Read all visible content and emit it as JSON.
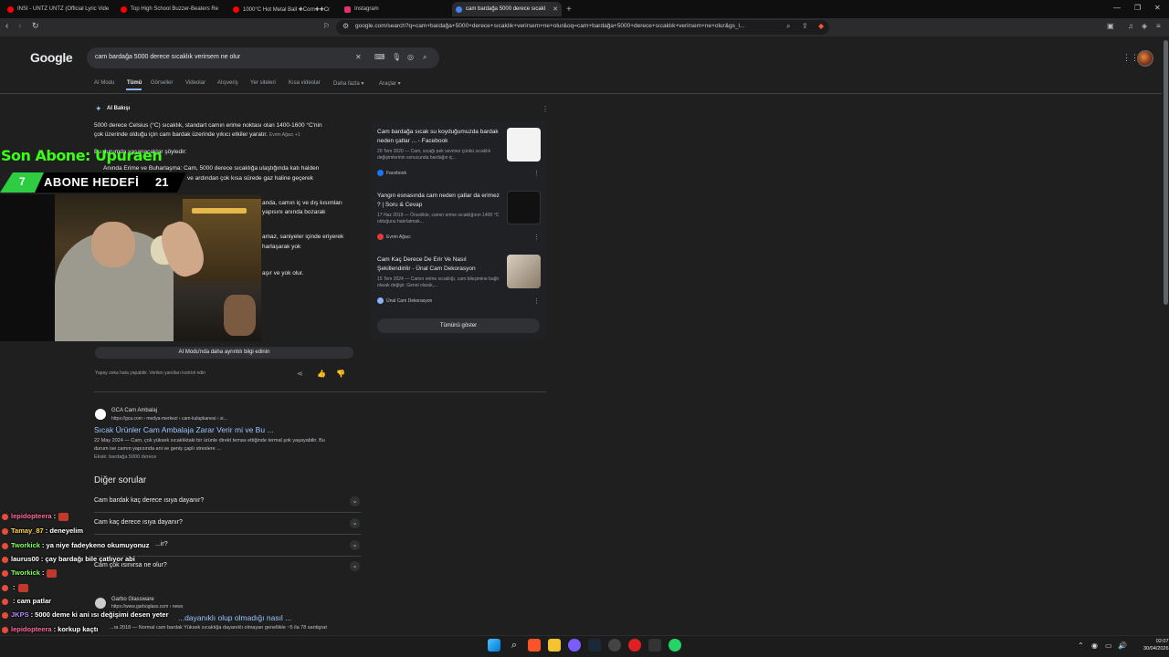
{
  "browser": {
    "tabs": [
      {
        "label": "INSI - UNTZ UNTZ (Official Lyric Vide",
        "color": "#ff0000"
      },
      {
        "label": "Top High School Buzzer-Beaters Re",
        "color": "#ff0000"
      },
      {
        "label": "1000°C Hot Metal Ball ✚Corn✚✚Cr",
        "color": "#ff0000"
      },
      {
        "label": "Instagram",
        "color": "#e1306c"
      },
      {
        "label": "cam bardağa 5000 derece sıcakl",
        "color": "#4285f4"
      }
    ],
    "new_tab": "+",
    "url": "google.com/search?q=cam+bardağa+5000+derece+sıcaklık+verirsem+ne+olur&oq=cam+bardağa+5000+derece+sıcaklık+verirsem+ne+olur&gs_l..."
  },
  "google": {
    "logo": "Google",
    "query": "cam bardağa 5000 derece sıcaklık verirsem ne olur",
    "filters": [
      "AI Modu",
      "Tümü",
      "Görseller",
      "Videolar",
      "Alışveriş",
      "Yer siteleri",
      "Kısa videolar",
      "Daha fazla ▾",
      "Araçlar ▾"
    ]
  },
  "ai_overview": {
    "label": "AI Bakışı",
    "lines": [
      "5000 derece Celsius (°C) sıcaklık, standart camın erime noktası olan 1400-1600 °C'nin",
      "çok üzerinde olduğu için cam bardak üzerinde yıkıcı etkiler yaratır.",
      "Bu durumda yaşanacaklar şöyledir:",
      "Anında Erime ve Buharlaşma: Cam, 5000 derece sıcaklığa ulaştığında katı halden",
      "ve ardından çok kısa sürede gaz haline geçerek",
      "anda, camın iç ve dış kısımları",
      "yapısını anında bozarak",
      "amaz, saniyeler içinde eriyerek",
      "harlaşarak yok",
      "aşır ve yok olur."
    ],
    "cite": "Evrim Ağacı +1",
    "more_button": "AI Modu'nda daha ayrıntılı bilgi edinin",
    "disclaimer": "Yapay zeka hata yapabilir. Verilen yanıtları kontrol edin"
  },
  "sources": [
    {
      "title": "Cam bardağa sıcak su koyduğumuzda bardak neden çatlar ... - Facebook",
      "snippet": "20 Tem 2020 — Cam, sıcağı pek sevmez çünkü sıcaklık değişimlerinin sonucunda bardağın iç...",
      "site": "Facebook",
      "color": "#1877f2"
    },
    {
      "title": "Yangın esnasında cam neden çatlar da erimez ? | Soru & Cevap",
      "snippet": "17 Haz 2019 — Öncelikle, camın erime sıcaklığının 1400 °C olduğunu hatırlatmak...",
      "site": "Evrim Ağacı",
      "color": "#e53935"
    },
    {
      "title": "Cam Kaç Derece De Erir Ve Nasıl Şekillendirilir - Ünal Cam Dekorasyon",
      "snippet": "15 Tem 2024 — Camın erime sıcaklığı, cam bileşimine bağlı olarak değişir. Genel olarak,...",
      "site": "Ünal Cam Dekorasyon",
      "color": "#8ab4f8"
    }
  ],
  "show_all": "Tümünü göster",
  "result1": {
    "site": "GCA Cam Ambalaj",
    "url": "https://gca.com › medya-merkezi › cam-kulupkanesi › si...",
    "title": "Sıcak Ürünler Cam Ambalaja Zarar Verir mi ve Bu ...",
    "snippet1": "22 May 2024 — Cam, çok yüksek sıcaklıktaki bir ürünle direkt temas ettiğinde termal şok yaşayabilir. Bu",
    "snippet2": "durum ise camın yapısında ani ve geniş çaplı streslere ...",
    "missing": "Eksik: bardağa 5000 derece"
  },
  "paa": {
    "heading": "Diğer sorular",
    "questions": [
      "Cam bardak kaç derece ısıya dayanır?",
      "Cam kaç derece ısıya dayanır?",
      "...ir?",
      "Cam çok ısınırsa ne olur?"
    ]
  },
  "result2": {
    "site": "Garbo Glassware",
    "url": "https://www.garboglass.com › news",
    "title": "...dayanıklı olup olmadığı nasıl ...",
    "snippet": "...ra 2018 — Normal cam bardak Yüksek sıcaklığa dayanıklı olmayan genellikle ~5 ila 78 santigrat"
  },
  "stream": {
    "last_sub": "Son Abone: Upuraen",
    "goal_current": "7",
    "goal_label": "ABONE HEDEFİ",
    "goal_target": "21"
  },
  "chat": [
    {
      "user": "lepidopteera",
      "msg": ":",
      "color": "#ff6b9d",
      "emote": true
    },
    {
      "user": "Tamay_87",
      "msg": ": deneyelim",
      "color": "#ffd84a",
      "emote": false
    },
    {
      "user": "Tworkick",
      "msg": ": ya niye fadeykeno okumuyonuz",
      "color": "#7fff5a",
      "emote": false
    },
    {
      "user": "laurus00",
      "msg": ": çay bardağı bile çatlıyor abi",
      "color": "#ffffff",
      "emote": false
    },
    {
      "user": "Tworkick",
      "msg": ":",
      "color": "#7fff5a",
      "emote": true
    },
    {
      "user": "",
      "msg": ":",
      "color": "#ffffff",
      "emote": true
    },
    {
      "user": "",
      "msg": ": cam patlar",
      "color": "#ffffff",
      "emote": false
    },
    {
      "user": "JKPS",
      "msg": ": 5000 deme ki ani ısı değişimi desen yeter",
      "color": "#b388ff",
      "emote": false
    },
    {
      "user": "lepidopteera",
      "msg": ": korkup kaçtı",
      "color": "#ff6b9d",
      "emote": false
    },
    {
      "user": "Tworkick",
      "msg": ":",
      "color": "#7fff5a",
      "emote": true
    }
  ],
  "clock": {
    "time": "02:07",
    "date": "30/04/2026"
  }
}
